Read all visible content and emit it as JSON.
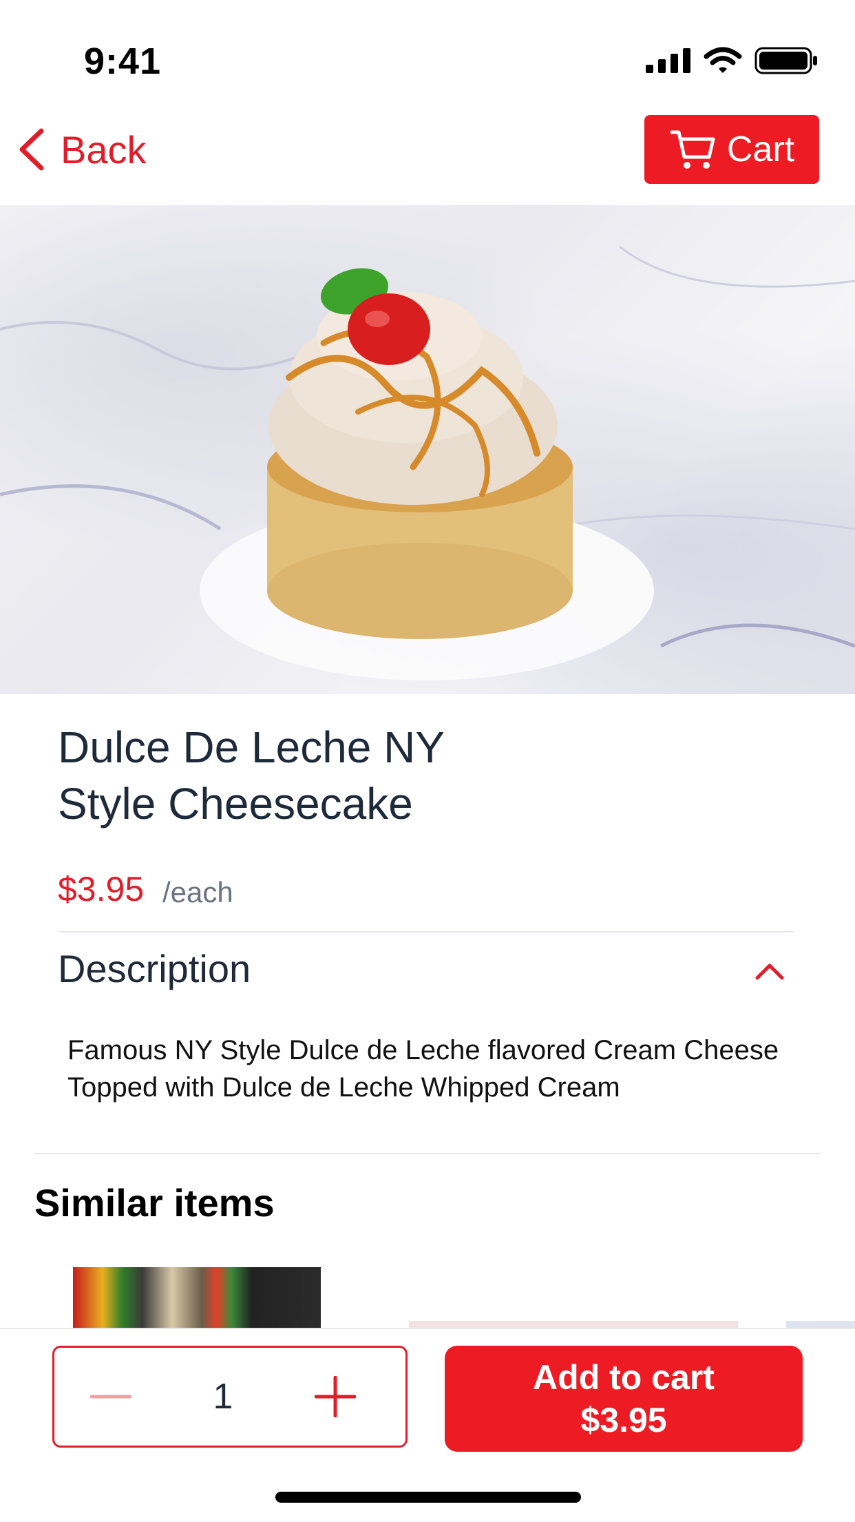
{
  "status_bar": {
    "time": "9:41"
  },
  "nav": {
    "back_label": "Back",
    "cart_label": "Cart"
  },
  "product": {
    "title_line1": "Dulce De Leche NY",
    "title_line2": "Style Cheesecake",
    "price": "$3.95",
    "unit": "/each"
  },
  "description": {
    "heading": "Description",
    "body": "Famous NY Style Dulce de Leche flavored Cream Cheese Topped with Dulce de Leche Whipped Cream"
  },
  "similar": {
    "heading": "Similar items"
  },
  "cart_bar": {
    "quantity": "1",
    "add_line1": "Add to cart",
    "add_line2": "$3.95"
  },
  "colors": {
    "accent": "#ed1c24",
    "text_dark": "#1e2a3a",
    "muted": "#6b7280"
  }
}
